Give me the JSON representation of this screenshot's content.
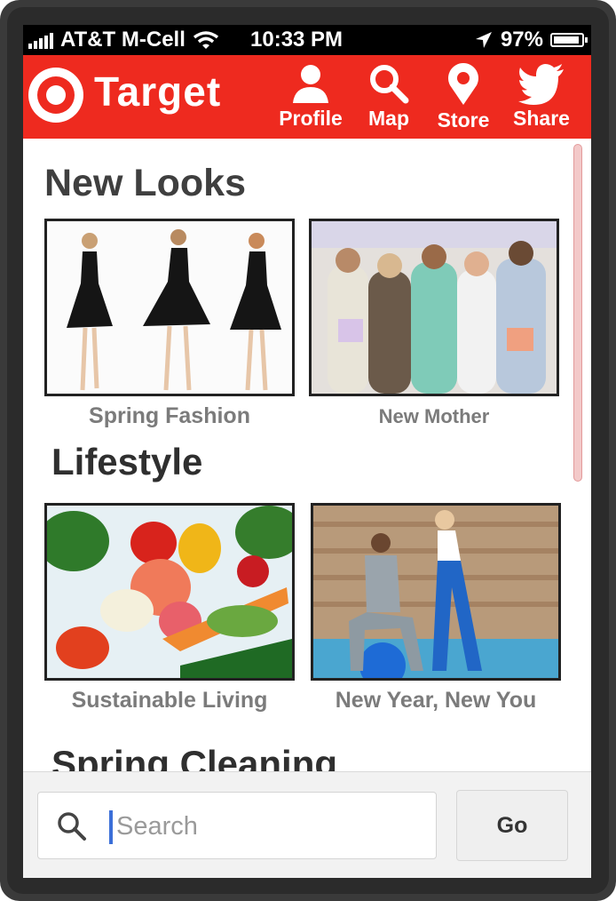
{
  "status_bar": {
    "carrier": "AT&T M-Cell",
    "time": "10:33 PM",
    "battery": "97%"
  },
  "header": {
    "brand": "Target",
    "nav": [
      {
        "label": "Profile",
        "icon": "person-icon"
      },
      {
        "label": "Map",
        "icon": "search-icon"
      },
      {
        "label": "Store",
        "icon": "map-pin-icon"
      },
      {
        "label": "Share",
        "icon": "twitter-bird-icon"
      }
    ]
  },
  "sections": [
    {
      "title": "New Looks",
      "tiles": [
        {
          "caption": "Spring Fashion",
          "image": "photo-dresses"
        },
        {
          "caption": "New Mother",
          "image": "photo-baby-shower"
        }
      ]
    },
    {
      "title": "Lifestyle",
      "tiles": [
        {
          "caption": "Sustainable Living",
          "image": "photo-vegetables"
        },
        {
          "caption": "New Year, New You",
          "image": "photo-fitness"
        }
      ]
    },
    {
      "title": "Spring Cleaning",
      "tiles": []
    }
  ],
  "search": {
    "placeholder": "Search",
    "go_label": "Go"
  },
  "colors": {
    "brand_red": "#ee2a1f",
    "status_bar": "#000000",
    "caption_gray": "#7b7b7b"
  }
}
